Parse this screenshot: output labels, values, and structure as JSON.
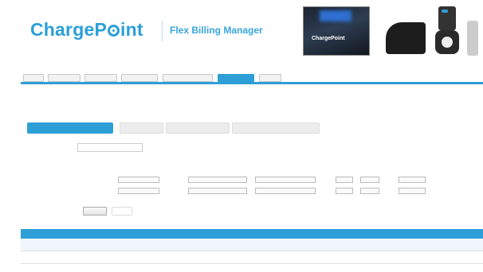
{
  "header": {
    "logo_left": "ChargeP",
    "logo_right": "int",
    "logo_tagline": "",
    "app_title": "Flex Billing Manager",
    "hero_label": "ChargePoint",
    "hero_caption": ""
  },
  "tabs": [
    {
      "label": "",
      "active": false
    },
    {
      "label": "",
      "active": false
    },
    {
      "label": "",
      "active": false
    },
    {
      "label": "",
      "active": false
    },
    {
      "label": "",
      "active": false
    },
    {
      "label": "",
      "active": true
    },
    {
      "label": "",
      "active": false
    }
  ],
  "section_title": "",
  "subtabs": [
    {
      "label": "",
      "active": true
    },
    {
      "label": "",
      "active": false
    },
    {
      "label": "",
      "active": false
    },
    {
      "label": "",
      "active": false
    }
  ],
  "profile": {
    "label": "",
    "value": ""
  },
  "pricing": {
    "label": "",
    "columns": {
      "type": "",
      "days": "",
      "duration": "",
      "fixed": "",
      "rate": "",
      "priority": ""
    },
    "rows": [
      {
        "type": "",
        "day_from": "",
        "time_from": "",
        "time_to": "",
        "fixed": "",
        "rate": "",
        "priority": "",
        "action": ""
      },
      {
        "type": "",
        "day_from": "",
        "time_from": "",
        "time_to": "",
        "fixed": "",
        "rate": "",
        "priority": "",
        "action": ""
      }
    ],
    "submit_label": "",
    "cancel_label": ""
  },
  "table": {
    "headers": [
      "",
      "",
      "",
      "",
      "",
      ""
    ],
    "rows": [
      [
        "",
        "",
        "",
        "",
        "",
        ""
      ],
      [
        "",
        "",
        "",
        "",
        "",
        ""
      ]
    ]
  },
  "colors": {
    "accent": "#2e9fd6",
    "text": "#333333"
  }
}
